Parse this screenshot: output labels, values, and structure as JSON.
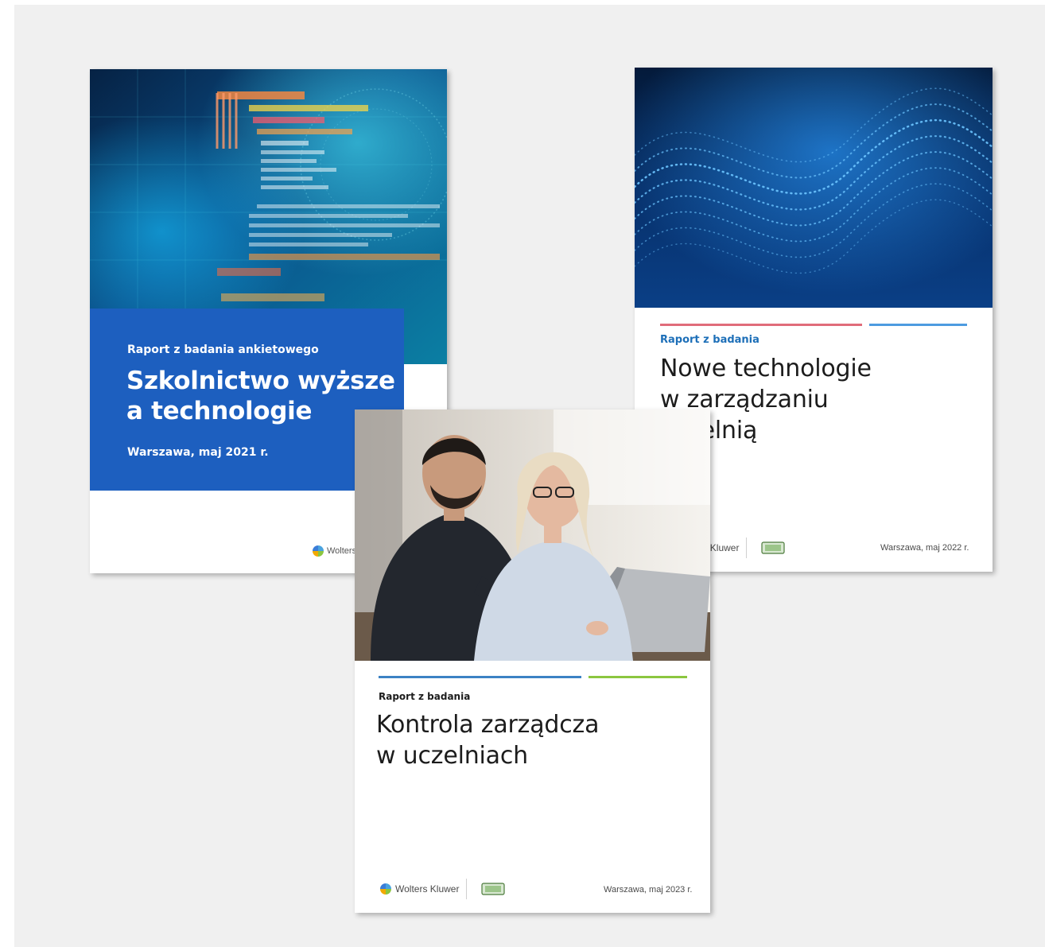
{
  "colors": {
    "background": "#f0f0f0",
    "cover1_band": "#1d5fbf",
    "cover2_rule_left": "#e06c7a",
    "cover2_rule_right": "#4d9be0",
    "cover2_eyebrow": "#1d6fb8",
    "cover3_rule_left": "#3b82c4",
    "cover3_rule_right": "#8cc63f"
  },
  "cover1": {
    "eyebrow": "Raport z badania ankietowego",
    "title_line1": "Szkolnictwo wyższe",
    "title_line2": "a technologie",
    "date": "Warszawa, maj 2021 r.",
    "logo_text": "Wolters K",
    "image": "code-and-globe-photo"
  },
  "cover2": {
    "eyebrow": "Raport z badania",
    "title_line1": "Nowe technologie",
    "title_line2": "w zarządzaniu",
    "title_line3": "uczelnią",
    "logo_text": "Wolters Kluwer",
    "date": "Warszawa, maj 2022 r.",
    "image": "blue-particle-wave"
  },
  "cover3": {
    "eyebrow": "Raport z badania",
    "title_line1": "Kontrola zarządcza",
    "title_line2": "w uczelniach",
    "logo_text": "Wolters Kluwer",
    "date": "Warszawa, maj 2023 r.",
    "image": "two-people-at-laptop-photo"
  }
}
